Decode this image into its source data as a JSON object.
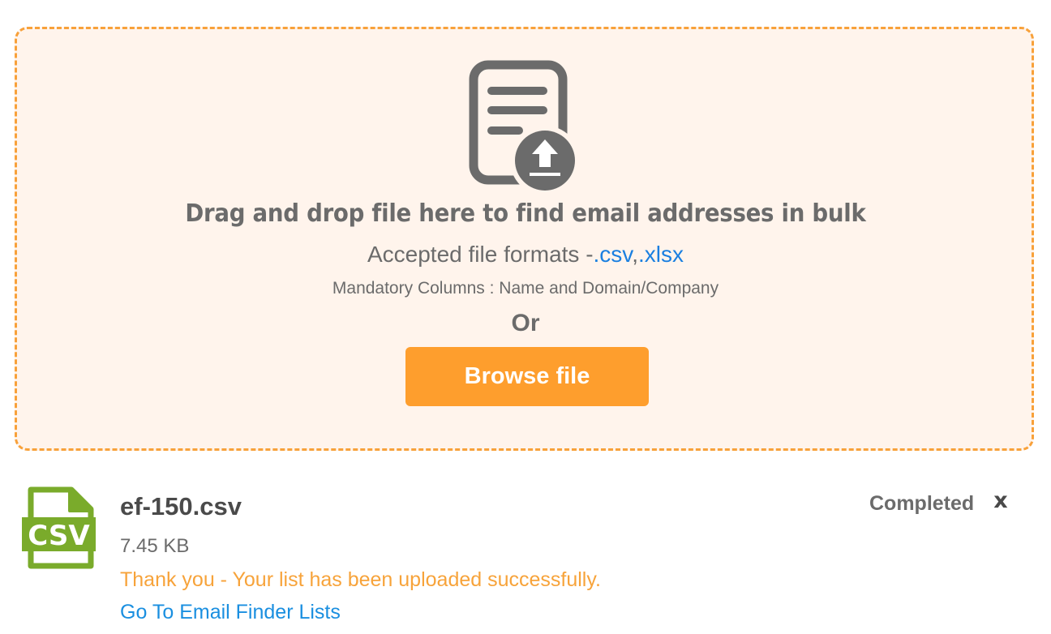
{
  "dropzone": {
    "icon": "document-upload-icon",
    "title": "Drag and drop file here to find email addresses in bulk",
    "formats_prefix": "Accepted file formats -",
    "format_csv": ".csv",
    "format_sep": ",",
    "format_xlsx": ".xlsx",
    "mandatory": "Mandatory Columns : Name and Domain/Company",
    "or_label": "Or",
    "browse_label": "Browse file"
  },
  "file": {
    "icon": "csv-file-icon",
    "icon_text": "CSV",
    "name": "ef-150.csv",
    "size": "7.45 KB",
    "status": "Completed",
    "remove_label": "x",
    "message": "Thank you - Your list has been uploaded successfully.",
    "link_label": "Go To Email Finder Lists"
  },
  "colors": {
    "accent": "#fe9e2d",
    "dropzone_bg": "#fff4ec",
    "link": "#1a8fe0",
    "success": "#f7a33a",
    "csv_green": "#7aab2b"
  }
}
